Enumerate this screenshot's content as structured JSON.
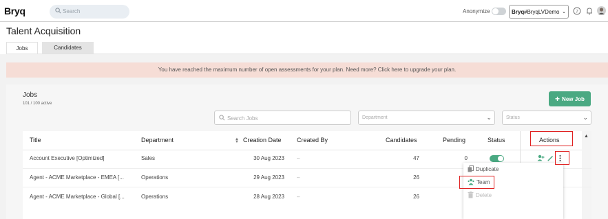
{
  "topbar": {
    "logo": "Bryq",
    "search_placeholder": "Search",
    "anonymize_label": "Anonymize",
    "account": {
      "brand": "Bryq",
      "name": "#BryqLVDemo"
    }
  },
  "page": {
    "title": "Talent Acquisition",
    "tabs": [
      {
        "label": "Jobs"
      },
      {
        "label": "Candidates"
      }
    ]
  },
  "banner": {
    "text": "You have reached the maximum number of open assessments for your plan. Need more? Click here to upgrade your plan."
  },
  "jobs": {
    "heading": "Jobs",
    "count": "101 / 100 active",
    "new_job_label": "New Job",
    "search_placeholder": "Search Jobs",
    "department_placeholder": "Department",
    "status_placeholder": "Status"
  },
  "table": {
    "columns": [
      "Title",
      "Department",
      "Creation Date",
      "Created By",
      "Candidates",
      "Pending",
      "Status",
      "Actions"
    ],
    "rows": [
      {
        "title": "Account Executive [Optimized]",
        "department": "Sales",
        "date": "30 Aug 2023",
        "created_by": "–",
        "candidates": "47",
        "pending": "0"
      },
      {
        "title": "Agent - ACME Marketplace - EMEA [...",
        "department": "Operations",
        "date": "29 Aug 2023",
        "created_by": "–",
        "candidates": "26",
        "pending": ""
      },
      {
        "title": "Agent - ACME Marketplace - Global [...",
        "department": "Operations",
        "date": "28 Aug 2023",
        "created_by": "–",
        "candidates": "26",
        "pending": ""
      }
    ]
  },
  "menu": {
    "items": [
      {
        "label": "Duplicate"
      },
      {
        "label": "Team"
      },
      {
        "label": "Delete"
      }
    ]
  },
  "colors": {
    "accent": "#4aa982",
    "banner_bg": "#f6ddd6",
    "highlight": "#e02020"
  }
}
